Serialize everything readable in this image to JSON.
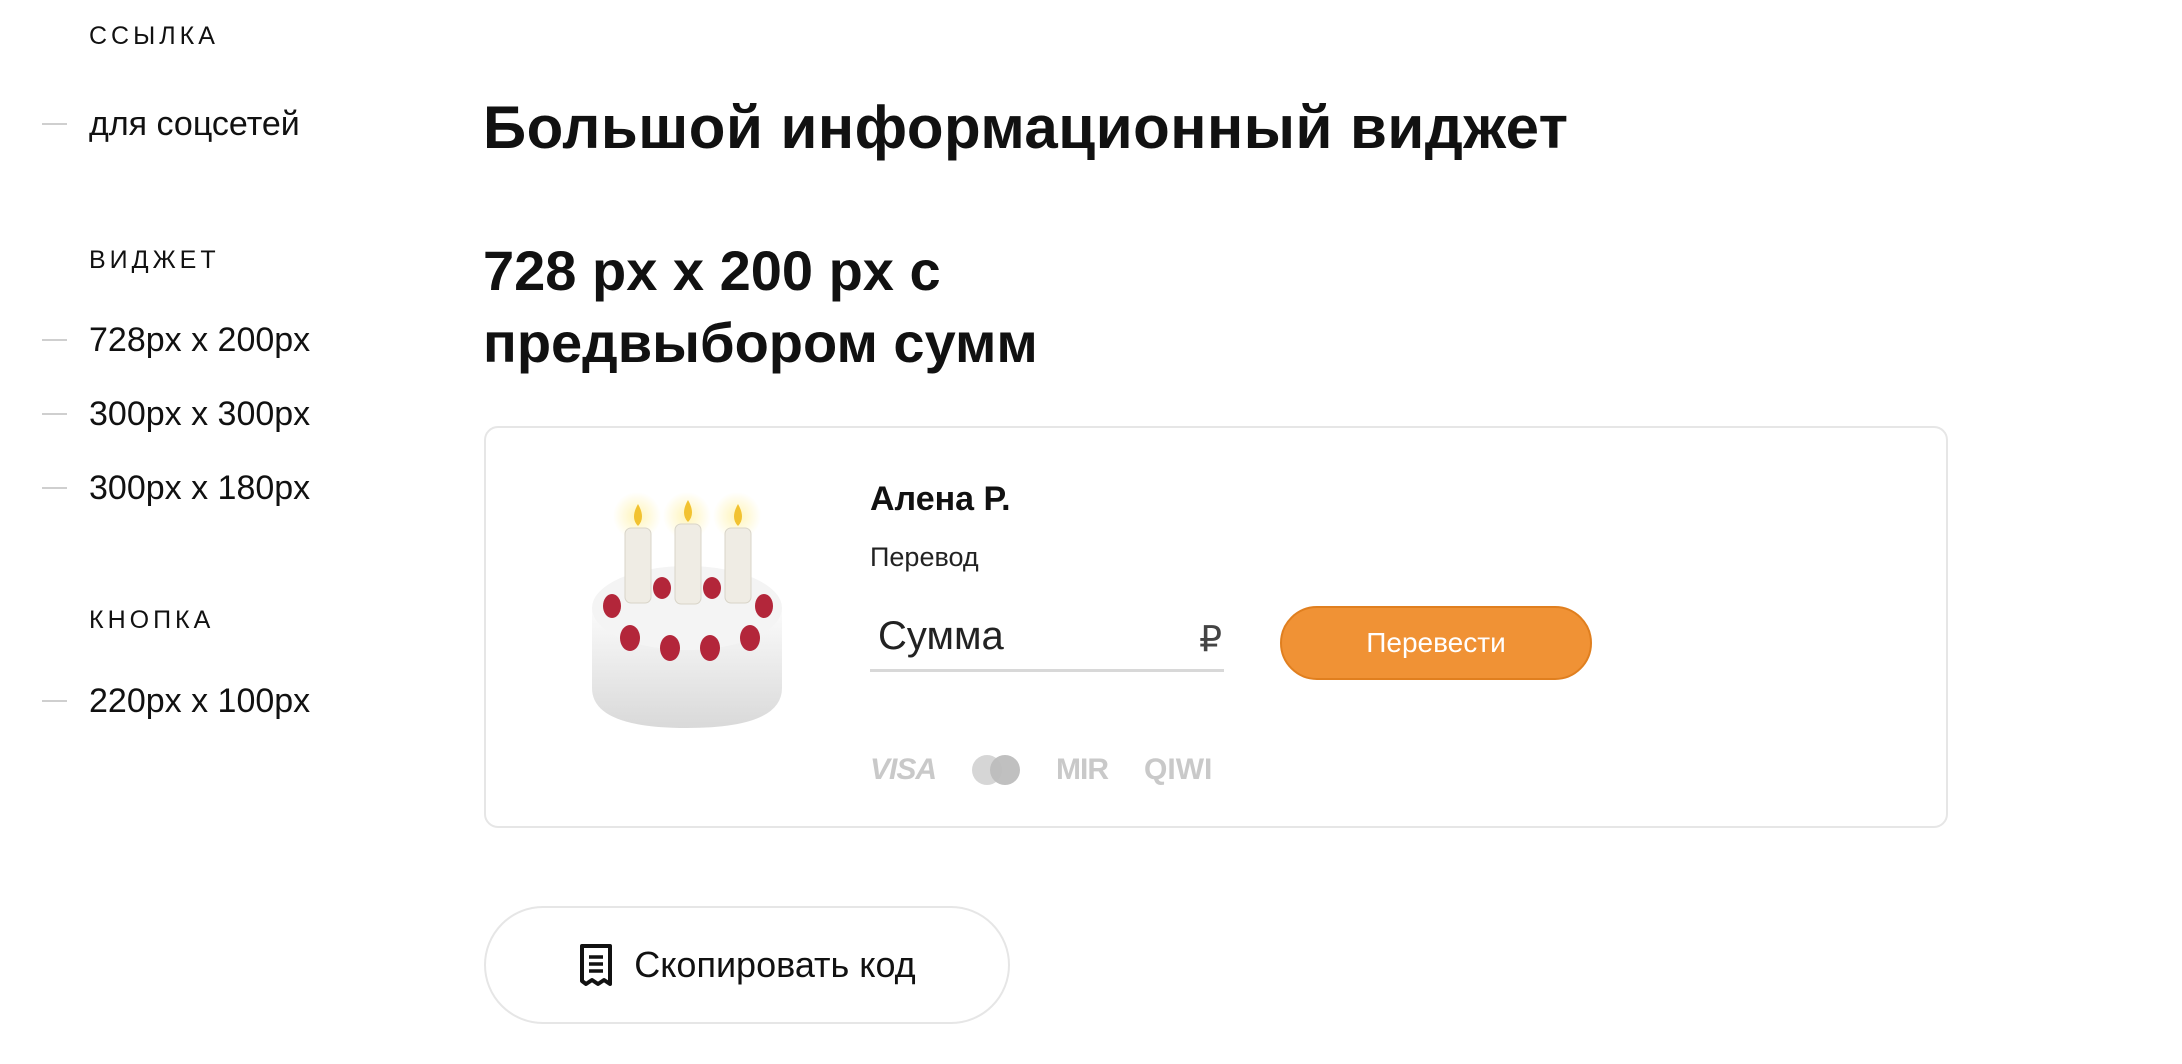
{
  "sidebar": {
    "sections": [
      {
        "title": "ССЫЛКА",
        "items": [
          {
            "label": "для соцсетей"
          }
        ]
      },
      {
        "title": "ВИДЖЕТ",
        "items": [
          {
            "label": "728px x 200px"
          },
          {
            "label": "300px x 300px"
          },
          {
            "label": "300px x 180px"
          }
        ]
      },
      {
        "title": "КНОПКА",
        "items": [
          {
            "label": "220px x 100px"
          }
        ]
      }
    ]
  },
  "main": {
    "title": "Большой информационный виджет",
    "subtitle": "728 px x 200 px с предвыбором сумм"
  },
  "widget": {
    "cake_icon": "birthday-cake-icon",
    "author": "Алена Р.",
    "label": "Перевод",
    "amount_placeholder": "Сумма",
    "currency": "₽",
    "submit_label": "Перевести",
    "accent_color": "#f09235",
    "payment_methods": [
      "VISA",
      "mastercard",
      "MIR",
      "QIWI"
    ]
  },
  "copy_button": {
    "label": "Скопировать код",
    "icon": "document-icon"
  }
}
